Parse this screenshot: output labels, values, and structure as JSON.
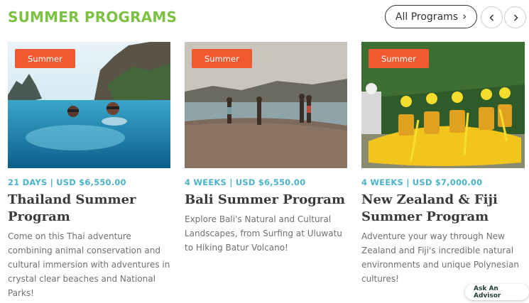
{
  "header": {
    "title": "SUMMER PROGRAMS",
    "all_programs_label": "All Programs",
    "all_programs_icon": "chevron-right-icon",
    "prev_icon": "chevron-left-icon",
    "next_icon": "chevron-right-icon"
  },
  "colors": {
    "accent_green": "#7dc142",
    "badge_orange": "#f15a30",
    "meta_teal": "#4ab3c9",
    "title_dark": "#3a3a3a"
  },
  "programs": [
    {
      "badge": "Summer",
      "meta": "21 DAYS | USD $6,550.00",
      "title": "Thailand Summer Program",
      "description": "Come on this Thai adventure combining animal conservation and cultural immersion with adventures in crystal clear beaches and National Parks!"
    },
    {
      "badge": "Summer",
      "meta": "4 WEEKS | USD $6,550.00",
      "title": "Bali Summer Program",
      "description": "Explore Bali's Natural and Cultural Landscapes, from Surfing at Uluwatu to Hiking Batur Volcano!"
    },
    {
      "badge": "Summer",
      "meta": "4 WEEKS | USD $7,000.00",
      "title": "New Zealand & Fiji Summer Program",
      "description": "Adventure your way through New Zealand and Fiji's incredible natural environments and unique Polynesian cultures!"
    }
  ],
  "advisor": {
    "label": "Ask An Advisor"
  }
}
